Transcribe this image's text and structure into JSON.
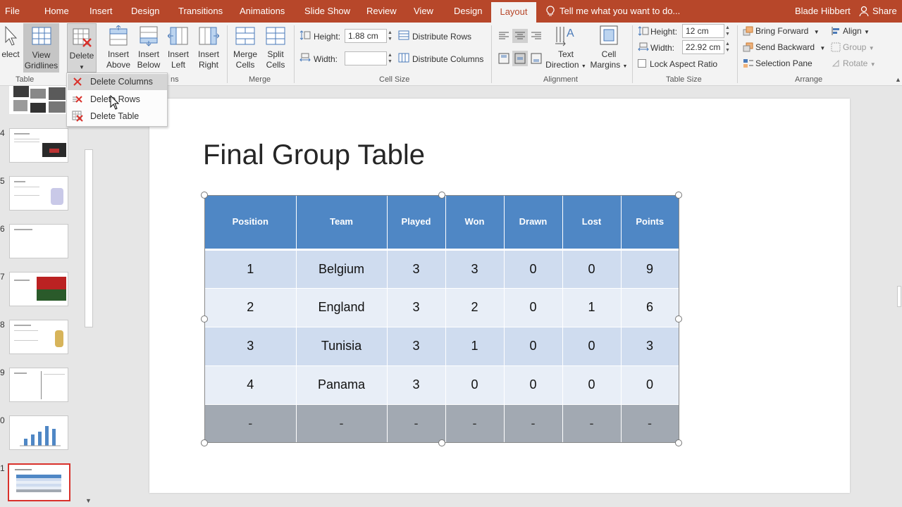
{
  "tabs": {
    "file": "File",
    "home": "Home",
    "insert": "Insert",
    "design": "Design",
    "transitions": "Transitions",
    "animations": "Animations",
    "slide_show": "Slide Show",
    "review": "Review",
    "view": "View",
    "table_design": "Design",
    "layout": "Layout",
    "tell_me": "Tell me what you want to do...",
    "user": "Blade Hibbert",
    "share": "Share"
  },
  "ribbon": {
    "select": "elect",
    "view_gridlines_1": "View",
    "view_gridlines_2": "Gridlines",
    "delete": "Delete",
    "insert_above_1": "Insert",
    "insert_above_2": "Above",
    "insert_below_1": "Insert",
    "insert_below_2": "Below",
    "insert_left_1": "Insert",
    "insert_left_2": "Left",
    "insert_right_1": "Insert",
    "insert_right_2": "Right",
    "merge_cells_1": "Merge",
    "merge_cells_2": "Cells",
    "split_cells_1": "Split",
    "split_cells_2": "Cells",
    "height_label": "Height:",
    "height_value": "1.88 cm",
    "width_label": "Width:",
    "width_value": "",
    "distribute_rows": "Distribute Rows",
    "distribute_columns": "Distribute Columns",
    "text_direction_1": "Text",
    "text_direction_2": "Direction",
    "cell_margins_1": "Cell",
    "cell_margins_2": "Margins",
    "table_height_label": "Height:",
    "table_height_value": "12 cm",
    "table_width_label": "Width:",
    "table_width_value": "22.92 cm",
    "lock_aspect": "Lock Aspect Ratio",
    "bring_forward": "Bring Forward",
    "send_backward": "Send Backward",
    "selection_pane": "Selection Pane",
    "align": "Align",
    "group": "Group",
    "rotate": "Rotate",
    "groups": {
      "table": "Table",
      "rows_columns": "ns",
      "merge": "Merge",
      "cell_size": "Cell Size",
      "alignment": "Alignment",
      "table_size": "Table Size",
      "arrange": "Arrange"
    }
  },
  "delete_menu": {
    "items": [
      "Delete Columns",
      "Delete Rows",
      "Delete Table"
    ]
  },
  "thumbnails": [
    "4",
    "5",
    "6",
    "7",
    "8",
    "9",
    "0",
    "1"
  ],
  "slide": {
    "title": "Final Group Table",
    "headers": [
      "Position",
      "Team",
      "Played",
      "Won",
      "Drawn",
      "Lost",
      "Points"
    ],
    "rows": [
      [
        "1",
        "Belgium",
        "3",
        "3",
        "0",
        "0",
        "9"
      ],
      [
        "2",
        "England",
        "3",
        "2",
        "0",
        "1",
        "6"
      ],
      [
        "3",
        "Tunisia",
        "3",
        "1",
        "0",
        "0",
        "3"
      ],
      [
        "4",
        "Panama",
        "3",
        "0",
        "0",
        "0",
        "0"
      ],
      [
        "-",
        "-",
        "-",
        "-",
        "-",
        "-",
        "-"
      ]
    ]
  },
  "colors": {
    "brand": "#b7472a",
    "header": "#4f87c5",
    "band_dark": "#cfdcef",
    "band_light": "#e8eef7",
    "total_row": "#a2a9b2",
    "delete_red": "#d9312b"
  }
}
